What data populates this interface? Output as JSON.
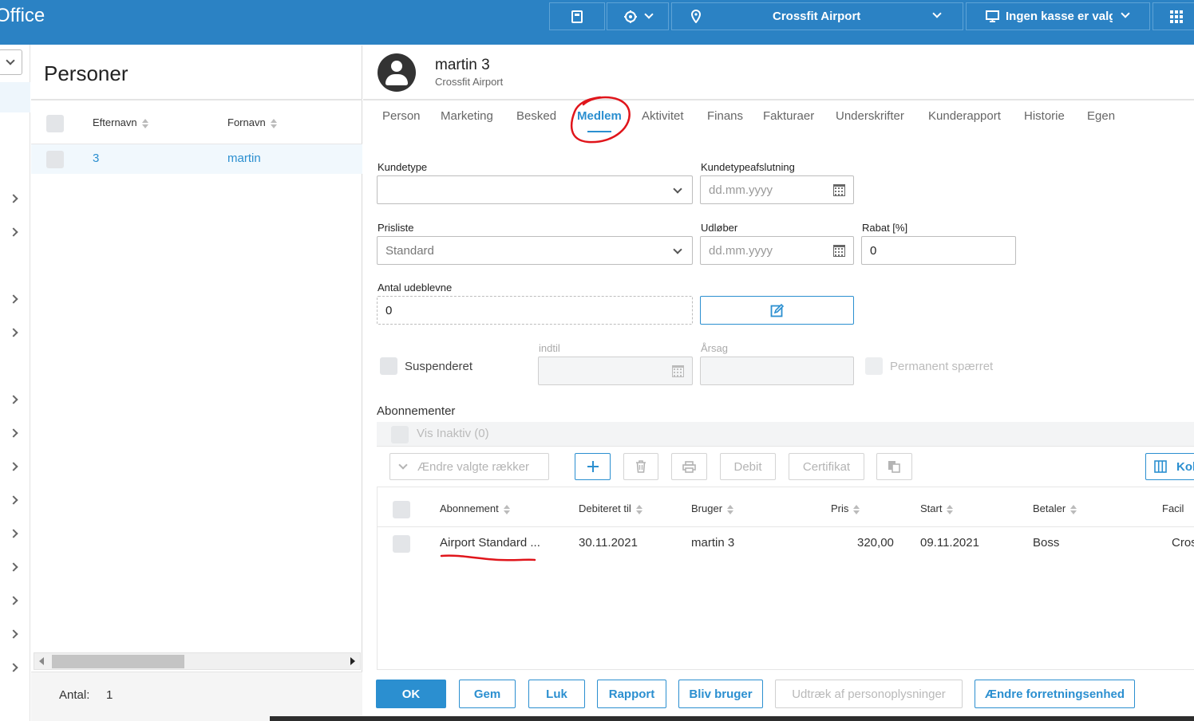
{
  "app": {
    "title": "Office"
  },
  "topbar": {
    "location": "Crossfit Airport",
    "register": "Ingen kasse er valg"
  },
  "persons": {
    "title": "Personer",
    "columns": {
      "last_name": "Efternavn",
      "first_name": "Fornavn"
    },
    "rows": [
      {
        "last_name": "3",
        "first_name": "martin"
      }
    ],
    "count_label": "Antal:",
    "count_value": "1"
  },
  "profile": {
    "name": "martin 3",
    "subtitle": "Crossfit Airport"
  },
  "tabs": [
    "Person",
    "Marketing",
    "Besked",
    "Medlem",
    "Aktivitet",
    "Finans",
    "Fakturaer",
    "Underskrifter",
    "Kunderapport",
    "Historie",
    "Egen"
  ],
  "active_tab": "Medlem",
  "form": {
    "kundetype_label": "Kundetype",
    "kundetype_value": "",
    "kundetypeafslutning_label": "Kundetypeafslutning",
    "kundetypeafslutning_placeholder": "dd.mm.yyyy",
    "prisliste_label": "Prisliste",
    "prisliste_value": "Standard",
    "udlober_label": "Udløber",
    "udlober_placeholder": "dd.mm.yyyy",
    "rabat_label": "Rabat [%]",
    "rabat_value": "0",
    "antal_label": "Antal udeblevne",
    "antal_value": "0",
    "suspenderet_label": "Suspenderet",
    "indtil_label": "indtil",
    "arsag_label": "Årsag",
    "permanent_label": "Permanent spærret"
  },
  "subscriptions": {
    "title": "Abonnementer",
    "show_inactive": "Vis Inaktiv (0)",
    "toolbar": {
      "bulk_edit": "Ændre valgte rækker",
      "debit": "Debit",
      "certificate": "Certifikat",
      "columns": "Kol"
    },
    "columns": [
      "Abonnement",
      "Debiteret til",
      "Bruger",
      "Pris",
      "Start",
      "Betaler",
      "Facil"
    ],
    "rows": [
      {
        "abonnement": "Airport Standard ...",
        "debiteret_til": "30.11.2021",
        "bruger": "martin 3",
        "pris": "320,00",
        "start": "09.11.2021",
        "betaler": "Boss",
        "facil": "Cros"
      }
    ]
  },
  "footer": {
    "ok": "OK",
    "gem": "Gem",
    "luk": "Luk",
    "rapport": "Rapport",
    "bliv_bruger": "Bliv bruger",
    "udtraek": "Udtræk af personoplysninger",
    "aendre": "Ændre forretningsenhed"
  },
  "colors": {
    "brand": "#2b82c4",
    "accent": "#2b8fd0",
    "annotation": "#e0151b"
  }
}
